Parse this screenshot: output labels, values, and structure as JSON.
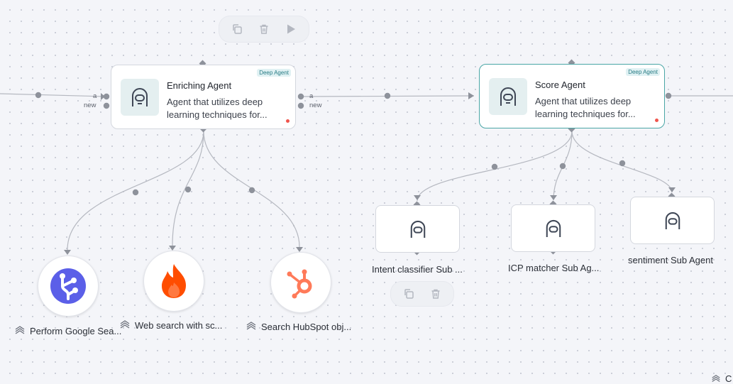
{
  "toolbars": {
    "top": {
      "copy": "copy-icon",
      "delete": "trash-icon",
      "run": "play-icon"
    },
    "bottom": {
      "copy": "copy-icon",
      "delete": "trash-icon"
    }
  },
  "agents": [
    {
      "title": "Enriching Agent",
      "badge": "Deep Agent",
      "description": "Agent that utilizes deep learning techniques for..."
    },
    {
      "title": "Score Agent",
      "badge": "Deep Agent",
      "description": "Agent that utilizes deep learning techniques for..."
    }
  ],
  "ports": {
    "a": "a",
    "new": "new"
  },
  "sub_agents": [
    {
      "label": "Intent classifier Sub ..."
    },
    {
      "label": "ICP matcher Sub Ag..."
    },
    {
      "label": "sentiment Sub Agent"
    }
  ],
  "tools": [
    {
      "label": "Perform Google Sea...",
      "icon": "google-search-icon"
    },
    {
      "label": "Web search with sc...",
      "icon": "firecrawl-flame-icon"
    },
    {
      "label": "Search HubSpot obj...",
      "icon": "hubspot-icon"
    }
  ],
  "offscreen_label": "C",
  "colors": {
    "accent": "#4aa6a6",
    "edge": "#b5b8c0",
    "node": "#8e929b",
    "hubspot": "#ff7a59",
    "flame": "#ff4d00",
    "google": "#5b5fe8"
  }
}
